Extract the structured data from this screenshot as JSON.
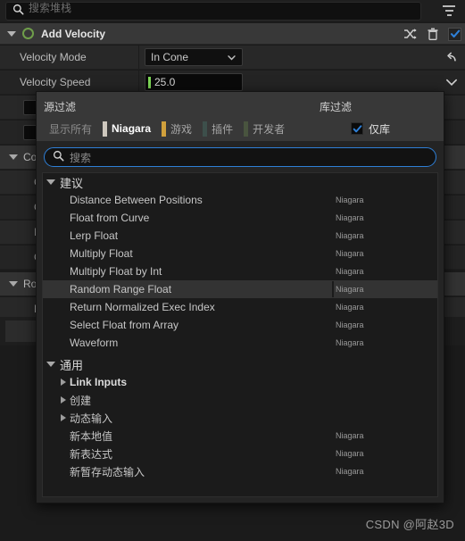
{
  "topbar": {
    "search_placeholder": "搜索堆栈",
    "menu_icon": "hamburger-icon",
    "search_icon": "search-icon"
  },
  "module": {
    "name": "Add Velocity",
    "expander_icon": "triangle-down-icon",
    "status_icon": "green-circle-icon",
    "actions": {
      "shuffle_label": "shuffle-icon",
      "delete_label": "trash-icon",
      "enabled_label": "check-icon"
    }
  },
  "properties": [
    {
      "label": "Velocity Mode",
      "type": "combo",
      "value": "In Cone",
      "right_icon": "undo-arrow-icon"
    },
    {
      "label": "Velocity Speed",
      "type": "number",
      "value": "25.0",
      "right_icon": "chevron-down-icon"
    }
  ],
  "background_rows": [
    {
      "text": "",
      "kind": "box"
    },
    {
      "text": "",
      "kind": "box"
    },
    {
      "text": "Cor",
      "kind": "group"
    },
    {
      "text": "Cor",
      "kind": "child"
    },
    {
      "text": "Cor",
      "kind": "child"
    },
    {
      "text": "Inn",
      "kind": "child"
    },
    {
      "text": "Cor",
      "kind": "child"
    },
    {
      "text": "Rot",
      "kind": "group"
    },
    {
      "text": "Rot",
      "kind": "child"
    }
  ],
  "popup": {
    "source_filter_label": "源过滤",
    "library_filter_label": "库过滤",
    "chips": [
      {
        "label": "显示所有",
        "color": "",
        "state": "showall"
      },
      {
        "label": "Niagara",
        "color": "#cdc7bd",
        "state": "active"
      },
      {
        "label": "游戏",
        "color": "#d0a03c",
        "state": "dim"
      },
      {
        "label": "插件",
        "color": "#3d4f4b",
        "state": "dim"
      },
      {
        "label": "开发者",
        "color": "#49543f",
        "state": "dim"
      }
    ],
    "library_chip": {
      "label": "仅库",
      "checked": true,
      "accent": "#2e7fd6"
    },
    "search_placeholder": "搜索",
    "search_icon": "search-icon",
    "groups": [
      {
        "title": "建议",
        "items": [
          {
            "name": "Distance Between Positions",
            "source": "Niagara",
            "selected": false,
            "expandable": false
          },
          {
            "name": "Float from Curve",
            "source": "Niagara",
            "selected": false,
            "expandable": false
          },
          {
            "name": "Lerp Float",
            "source": "Niagara",
            "selected": false,
            "expandable": false
          },
          {
            "name": "Multiply Float",
            "source": "Niagara",
            "selected": false,
            "expandable": false
          },
          {
            "name": "Multiply Float by Int",
            "source": "Niagara",
            "selected": false,
            "expandable": false
          },
          {
            "name": "Random Range Float",
            "source": "Niagara",
            "selected": true,
            "expandable": false
          },
          {
            "name": "Return Normalized Exec Index",
            "source": "Niagara",
            "selected": false,
            "expandable": false
          },
          {
            "name": "Select Float from Array",
            "source": "Niagara",
            "selected": false,
            "expandable": false
          },
          {
            "name": "Waveform",
            "source": "Niagara",
            "selected": false,
            "expandable": false
          }
        ]
      },
      {
        "title": "通用",
        "items": [
          {
            "name": "Link Inputs",
            "source": "",
            "selected": false,
            "expandable": true,
            "bold": true
          },
          {
            "name": "创建",
            "source": "",
            "selected": false,
            "expandable": true
          },
          {
            "name": "动态输入",
            "source": "",
            "selected": false,
            "expandable": true
          },
          {
            "name": "新本地值",
            "source": "Niagara",
            "selected": false,
            "expandable": false
          },
          {
            "name": "新表达式",
            "source": "Niagara",
            "selected": false,
            "expandable": false
          },
          {
            "name": "新暂存动态输入",
            "source": "Niagara",
            "selected": false,
            "expandable": false
          }
        ]
      }
    ]
  },
  "watermark": "CSDN @阿赵3D"
}
